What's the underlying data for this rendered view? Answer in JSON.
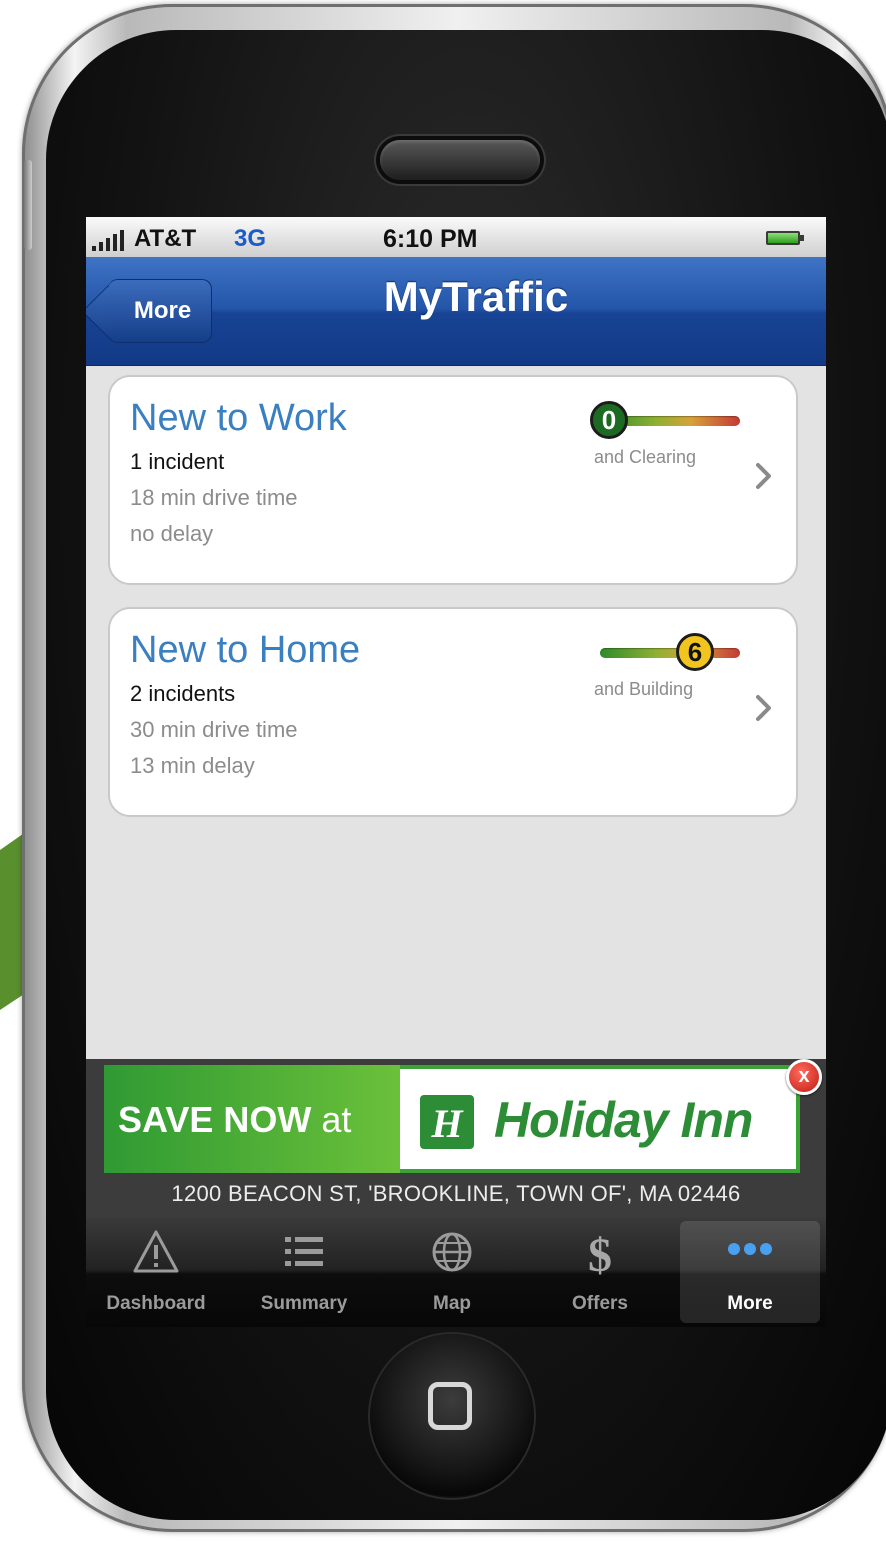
{
  "status_bar": {
    "carrier": "AT&T",
    "network": "3G",
    "time": "6:10 PM"
  },
  "nav": {
    "back_label": "More",
    "title": "MyTraffic"
  },
  "routes": [
    {
      "name": "New to Work",
      "incidents": "1 incident",
      "drive_time": "18 min drive time",
      "delay": "no delay",
      "trend_value": "0",
      "trend_label": "and Clearing",
      "trend_badge_color": "#1d6b22"
    },
    {
      "name": "New to Home",
      "incidents": "2 incidents",
      "drive_time": "30 min drive time",
      "delay": "13 min delay",
      "trend_value": "6",
      "trend_label": "and Building",
      "trend_badge_color": "#f2c51e"
    }
  ],
  "ad": {
    "save_text": "SAVE NOW",
    "save_at": "at",
    "brand": "Holiday Inn",
    "address": "1200  BEACON  ST, 'BROOKLINE, TOWN OF', MA 02446",
    "close_label": "x"
  },
  "tabs": [
    {
      "label": "Dashboard",
      "icon": "warning-icon"
    },
    {
      "label": "Summary",
      "icon": "list-icon"
    },
    {
      "label": "Map",
      "icon": "globe-icon"
    },
    {
      "label": "Offers",
      "icon": "dollar-icon"
    },
    {
      "label": "More",
      "icon": "more-icon"
    }
  ],
  "colors": {
    "nav_blue": "#1f4f9f",
    "route_title_blue": "#3a7fc0",
    "callout_green": "#5a8f2e",
    "ad_green": "#3aa335"
  }
}
